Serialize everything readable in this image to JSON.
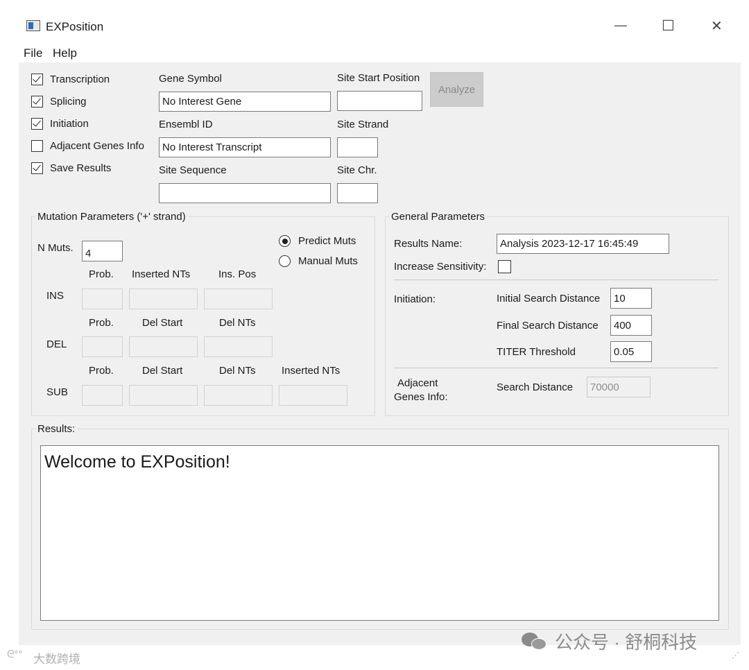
{
  "window": {
    "title": "EXPosition",
    "controls": {
      "minimize": "—",
      "maximize": "☐",
      "close": "✕"
    }
  },
  "menu": {
    "items": [
      "File",
      "Help"
    ]
  },
  "options": [
    {
      "label": "Transcription",
      "checked": true
    },
    {
      "label": "Splicing",
      "checked": true
    },
    {
      "label": "Initiation",
      "checked": true
    },
    {
      "label": "Adjacent Genes Info",
      "checked": false
    },
    {
      "label": "Save Results",
      "checked": true
    }
  ],
  "inputs": {
    "gene_symbol_label": "Gene Symbol",
    "gene_symbol_value": "No Interest Gene",
    "ensembl_label": "Ensembl ID",
    "ensembl_value": "No Interest Transcript",
    "site_sequence_label": "Site Sequence",
    "site_sequence_value": "",
    "site_start_label": "Site Start Position",
    "site_start_value": "",
    "site_strand_label": "Site Strand",
    "site_strand_value": "",
    "site_chr_label": "Site Chr.",
    "site_chr_value": "",
    "analyze_label": "Analyze"
  },
  "mutation": {
    "title": "Mutation Parameters ('+' strand)",
    "n_muts_label": "N Muts.",
    "n_muts_value": "4",
    "predict_label": "Predict Muts",
    "manual_label": "Manual Muts",
    "mode": "predict",
    "ins": {
      "label": "INS",
      "headers": [
        "Prob.",
        "Inserted NTs",
        "Ins. Pos"
      ]
    },
    "del": {
      "label": "DEL",
      "headers": [
        "Prob.",
        "Del Start",
        "Del NTs"
      ]
    },
    "sub": {
      "label": "SUB",
      "headers": [
        "Prob.",
        "Del Start",
        "Del NTs",
        "Inserted NTs"
      ]
    }
  },
  "general": {
    "title": "General Parameters",
    "results_name_label": "Results Name:",
    "results_name_value": "Analysis 2023-12-17 16:45:49",
    "sensitivity_label": "Increase Sensitivity:",
    "sensitivity_checked": false,
    "initiation_label": "Initiation:",
    "initial_search_label": "Initial Search Distance",
    "initial_search_value": "10",
    "final_search_label": "Final Search Distance",
    "final_search_value": "400",
    "titer_label": "TITER Threshold",
    "titer_value": "0.05",
    "adjacent_label_line1": "Adjacent",
    "adjacent_label_line2": "Genes Info:",
    "search_distance_label": "Search Distance",
    "search_distance_value": "70000"
  },
  "results": {
    "title": "Results:",
    "text": "Welcome to EXPosition!"
  },
  "watermarks": {
    "bottom_right": "公众号 · 舒桐科技",
    "bottom_left": "大数跨境"
  }
}
